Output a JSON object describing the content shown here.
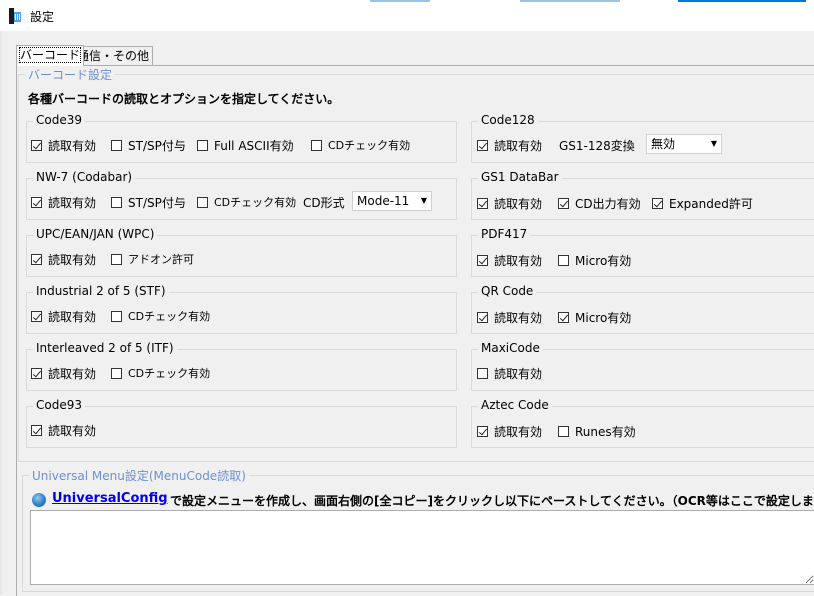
{
  "window": {
    "title": "設定"
  },
  "tabs": [
    {
      "label": "バーコード"
    },
    {
      "label": "通信・その他"
    }
  ],
  "barcode_group": {
    "label": "バーコード設定",
    "instruction": "各種バーコードの読取とオプションを指定してください。"
  },
  "groups": {
    "code39": {
      "label": "Code39",
      "read": "読取有効",
      "stsp": "ST/SP付与",
      "full_ascii": "Full ASCII有効",
      "cd_check": "CDチェック有効"
    },
    "nw7": {
      "label": "NW-7 (Codabar)",
      "read": "読取有効",
      "stsp": "ST/SP付与",
      "cd_check": "CDチェック有効",
      "cd_format_label": "CD形式",
      "cd_format_value": "Mode-11"
    },
    "upc": {
      "label": "UPC/EAN/JAN (WPC)",
      "read": "読取有効",
      "addon": "アドオン許可"
    },
    "ind2of5": {
      "label": "Industrial 2 of 5 (STF)",
      "read": "読取有効",
      "cd_check": "CDチェック有効"
    },
    "int2of5": {
      "label": "Interleaved 2 of 5 (ITF)",
      "read": "読取有効",
      "cd_check": "CDチェック有効"
    },
    "code93": {
      "label": "Code93",
      "read": "読取有効"
    },
    "code128": {
      "label": "Code128",
      "read": "読取有効",
      "gs1_label": "GS1-128変換",
      "gs1_value": "無効"
    },
    "gs1databar": {
      "label": "GS1 DataBar",
      "read": "読取有効",
      "cd_output": "CD出力有効",
      "expanded": "Expanded許可"
    },
    "pdf417": {
      "label": "PDF417",
      "read": "読取有効",
      "micro": "Micro有効"
    },
    "qr": {
      "label": "QR Code",
      "read": "読取有効",
      "micro": "Micro有効"
    },
    "maxicode": {
      "label": "MaxiCode",
      "read": "読取有効"
    },
    "aztec": {
      "label": "Aztec Code",
      "read": "読取有効",
      "runes": "Runes有効"
    }
  },
  "checked": {
    "code39_read": true,
    "code39_stsp": false,
    "code39_full_ascii": false,
    "code39_cd_check": false,
    "nw7_read": true,
    "nw7_stsp": false,
    "nw7_cd_check": false,
    "upc_read": true,
    "upc_addon": false,
    "ind2of5_read": true,
    "ind2of5_cd_check": false,
    "int2of5_read": true,
    "int2of5_cd_check": false,
    "code93_read": true,
    "code128_read": true,
    "gs1databar_read": true,
    "gs1databar_cd_output": true,
    "gs1databar_expanded": true,
    "pdf417_read": true,
    "pdf417_micro": false,
    "qr_read": true,
    "qr_micro": true,
    "maxicode_read": false,
    "aztec_read": true,
    "aztec_runes": false
  },
  "menucode": {
    "label": "Universal Menu設定(MenuCode読取)",
    "link": "UniversalConfig",
    "instruction": "で設定メニューを作成し、画面右側の[全コピー]をクリックし以下にペーストしてください。（OCR等はここで設定します。）",
    "textarea_value": ""
  },
  "icons": {
    "app": "app-icon",
    "globe": "globe-icon"
  },
  "colors": {
    "group_label_blue": "#6d8fd1",
    "link": "#0000ee",
    "title_accent": "#0078d7"
  }
}
